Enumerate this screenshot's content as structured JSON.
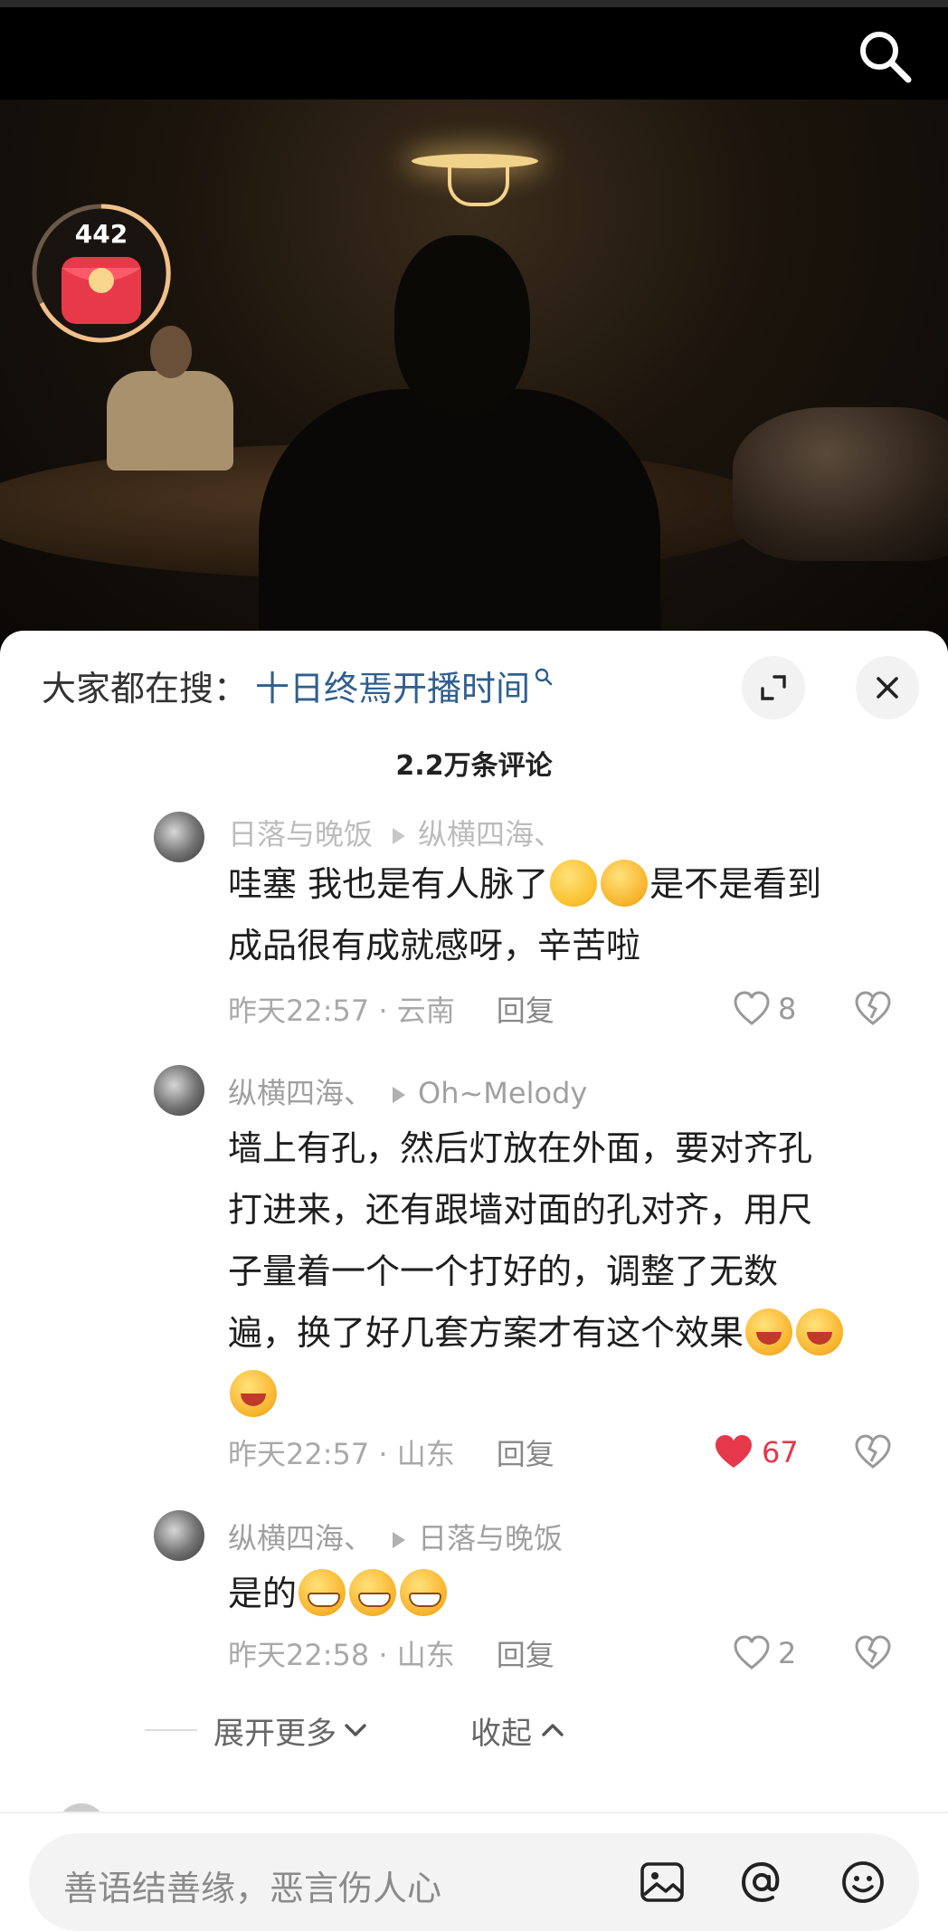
{
  "video": {
    "red_packet_count": "442"
  },
  "panel": {
    "search_prefix": "大家都在搜：",
    "search_term": "十日终焉开播时间",
    "comment_count": "2.2万条评论"
  },
  "comments": [
    {
      "author": "日落与晚饭",
      "reply_to": "纵横四海、",
      "text_1": "哇塞 我也是有人脉了",
      "text_2": "是不是看到",
      "text_3": "成品很有成就感呀，辛苦啦",
      "time": "昨天22:57 · 云南",
      "reply_label": "回复",
      "likes": "8",
      "liked": false
    },
    {
      "author": "纵横四海、",
      "reply_to": "Oh~Melody",
      "text_line1": "墙上有孔，然后灯放在外面，要对齐孔",
      "text_line2": "打进来，还有跟墙对面的孔对齐，用尺",
      "text_line3": "子量着一个一个打好的，调整了无数",
      "text_line4": "遍，换了好几套方案才有这个效果",
      "time": "昨天22:57 · 山东",
      "reply_label": "回复",
      "likes": "67",
      "liked": true
    },
    {
      "author": "纵横四海、",
      "reply_to": "日落与晚饭",
      "text": "是的",
      "time": "昨天22:58 · 山东",
      "reply_label": "回复",
      "likes": "2",
      "liked": false
    }
  ],
  "thread_controls": {
    "expand_more": "展开更多",
    "collapse": "收起"
  },
  "input": {
    "placeholder": "善语结善缘，恶言伤人心"
  },
  "colors": {
    "accent_blue": "#2f5f8f",
    "like_red": "#e5384b",
    "red_packet": "#e8394a"
  },
  "icons": [
    "search-icon",
    "red-packet-icon",
    "expand-icon",
    "close-icon",
    "heart-icon",
    "dislike-icon",
    "chevron-down-icon",
    "chevron-up-icon",
    "image-icon",
    "at-icon",
    "emoji-icon"
  ]
}
